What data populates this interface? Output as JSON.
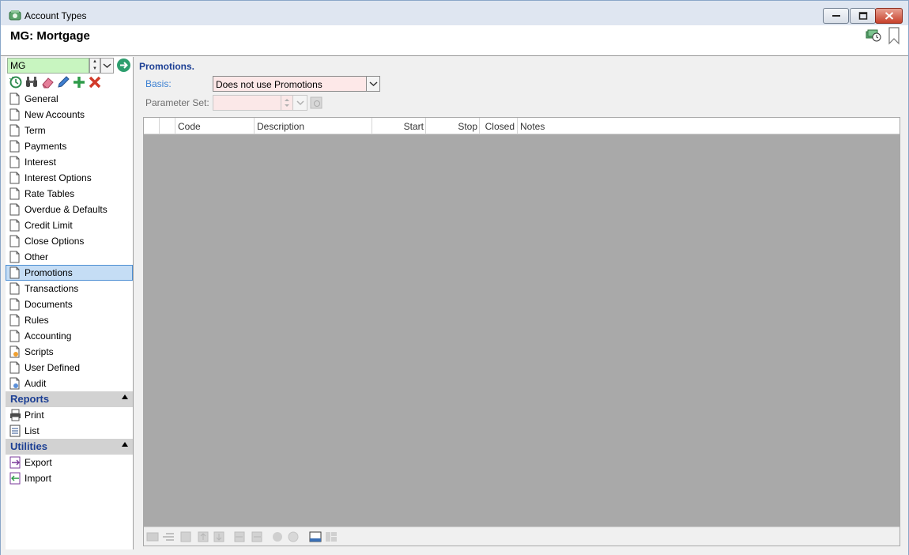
{
  "window": {
    "title": "Account Types"
  },
  "header": {
    "record_title": "MG: Mortgage"
  },
  "selector": {
    "value": "MG"
  },
  "nav": {
    "items": [
      {
        "label": "General"
      },
      {
        "label": "New Accounts"
      },
      {
        "label": "Term"
      },
      {
        "label": "Payments"
      },
      {
        "label": "Interest"
      },
      {
        "label": "Interest Options"
      },
      {
        "label": "Rate Tables"
      },
      {
        "label": "Overdue & Defaults"
      },
      {
        "label": "Credit Limit"
      },
      {
        "label": "Close Options"
      },
      {
        "label": "Other"
      },
      {
        "label": "Promotions"
      },
      {
        "label": "Transactions"
      },
      {
        "label": "Documents"
      },
      {
        "label": "Rules"
      },
      {
        "label": "Accounting"
      },
      {
        "label": "Scripts"
      },
      {
        "label": "User Defined"
      },
      {
        "label": "Audit"
      }
    ],
    "reports": {
      "title": "Reports",
      "items": [
        {
          "label": "Print"
        },
        {
          "label": "List"
        }
      ]
    },
    "utilities": {
      "title": "Utilities",
      "items": [
        {
          "label": "Export"
        },
        {
          "label": "Import"
        }
      ]
    }
  },
  "main": {
    "section_title": "Promotions.",
    "basis_label": "Basis:",
    "basis_value": "Does not use Promotions",
    "param_label": "Parameter Set:",
    "param_value": "",
    "grid": {
      "columns": [
        {
          "label": ""
        },
        {
          "label": ""
        },
        {
          "label": "Code"
        },
        {
          "label": "Description"
        },
        {
          "label": "Start"
        },
        {
          "label": "Stop"
        },
        {
          "label": "Closed"
        },
        {
          "label": "Notes"
        }
      ],
      "rows": []
    }
  }
}
